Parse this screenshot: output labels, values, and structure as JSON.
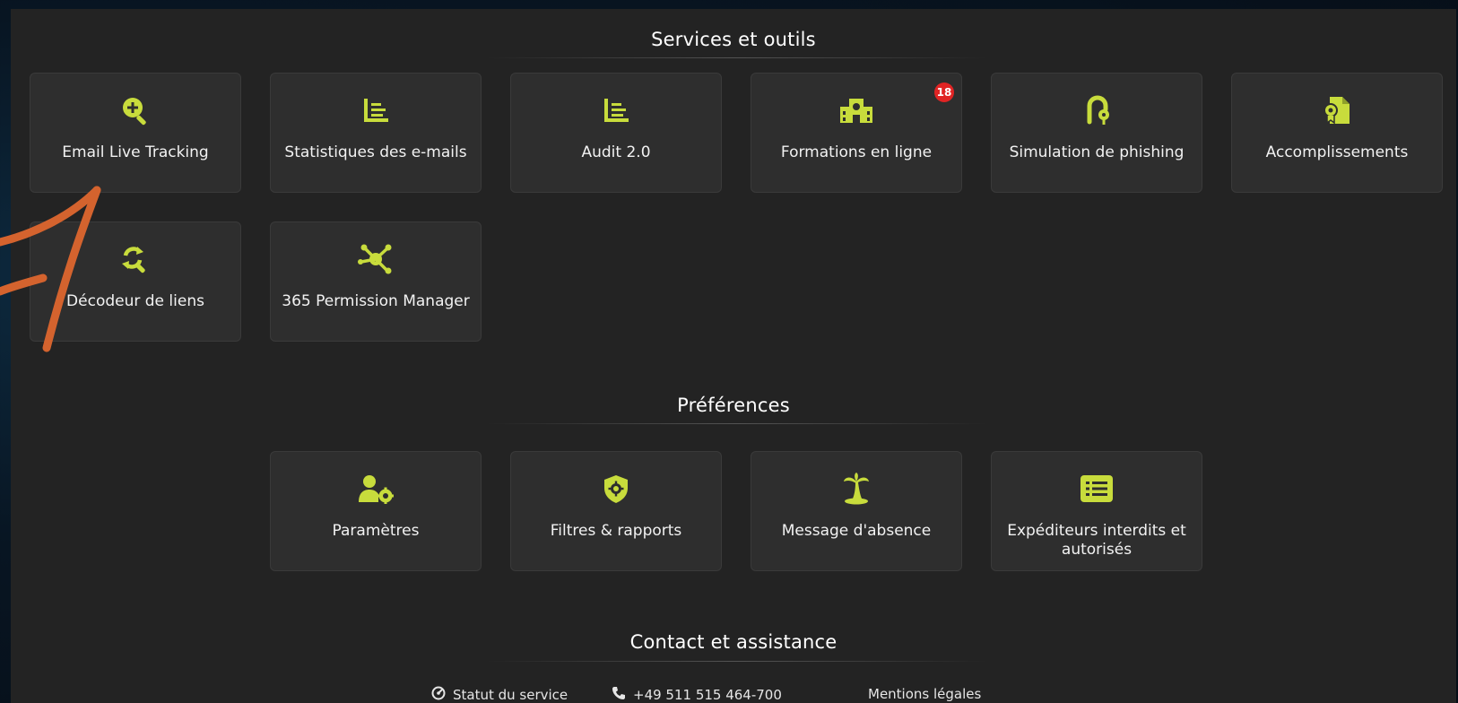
{
  "accent_color": "#c8dc3c",
  "sections": {
    "services": {
      "title": "Services et outils"
    },
    "preferences": {
      "title": "Préférences"
    },
    "contact": {
      "title": "Contact et assistance"
    }
  },
  "services": [
    {
      "label": "Email Live Tracking",
      "icon": "search-plus-icon"
    },
    {
      "label": "Statistiques des e-mails",
      "icon": "chart-lines-icon"
    },
    {
      "label": "Audit 2.0",
      "icon": "chart-lines-icon"
    },
    {
      "label": "Formations en ligne",
      "icon": "school-icon",
      "badge": "18"
    },
    {
      "label": "Simulation de phishing",
      "icon": "fishing-hook-icon"
    },
    {
      "label": "Accomplissements",
      "icon": "certificate-icon"
    },
    {
      "label": "Décodeur de liens",
      "icon": "search-refresh-icon"
    },
    {
      "label": "365 Permission Manager",
      "icon": "network-hub-icon"
    }
  ],
  "preferences": [
    {
      "label": "Paramètres",
      "icon": "user-gear-icon"
    },
    {
      "label": "Filtres & rapports",
      "icon": "shield-gear-icon"
    },
    {
      "label": "Message d'absence",
      "icon": "palm-tree-icon"
    },
    {
      "label": "Expéditeurs interdits et autorisés",
      "icon": "list-icon"
    }
  ],
  "footer": {
    "status": "Statut du service",
    "phone": "+49 511 515 464-700",
    "legal": "Mentions légales"
  }
}
